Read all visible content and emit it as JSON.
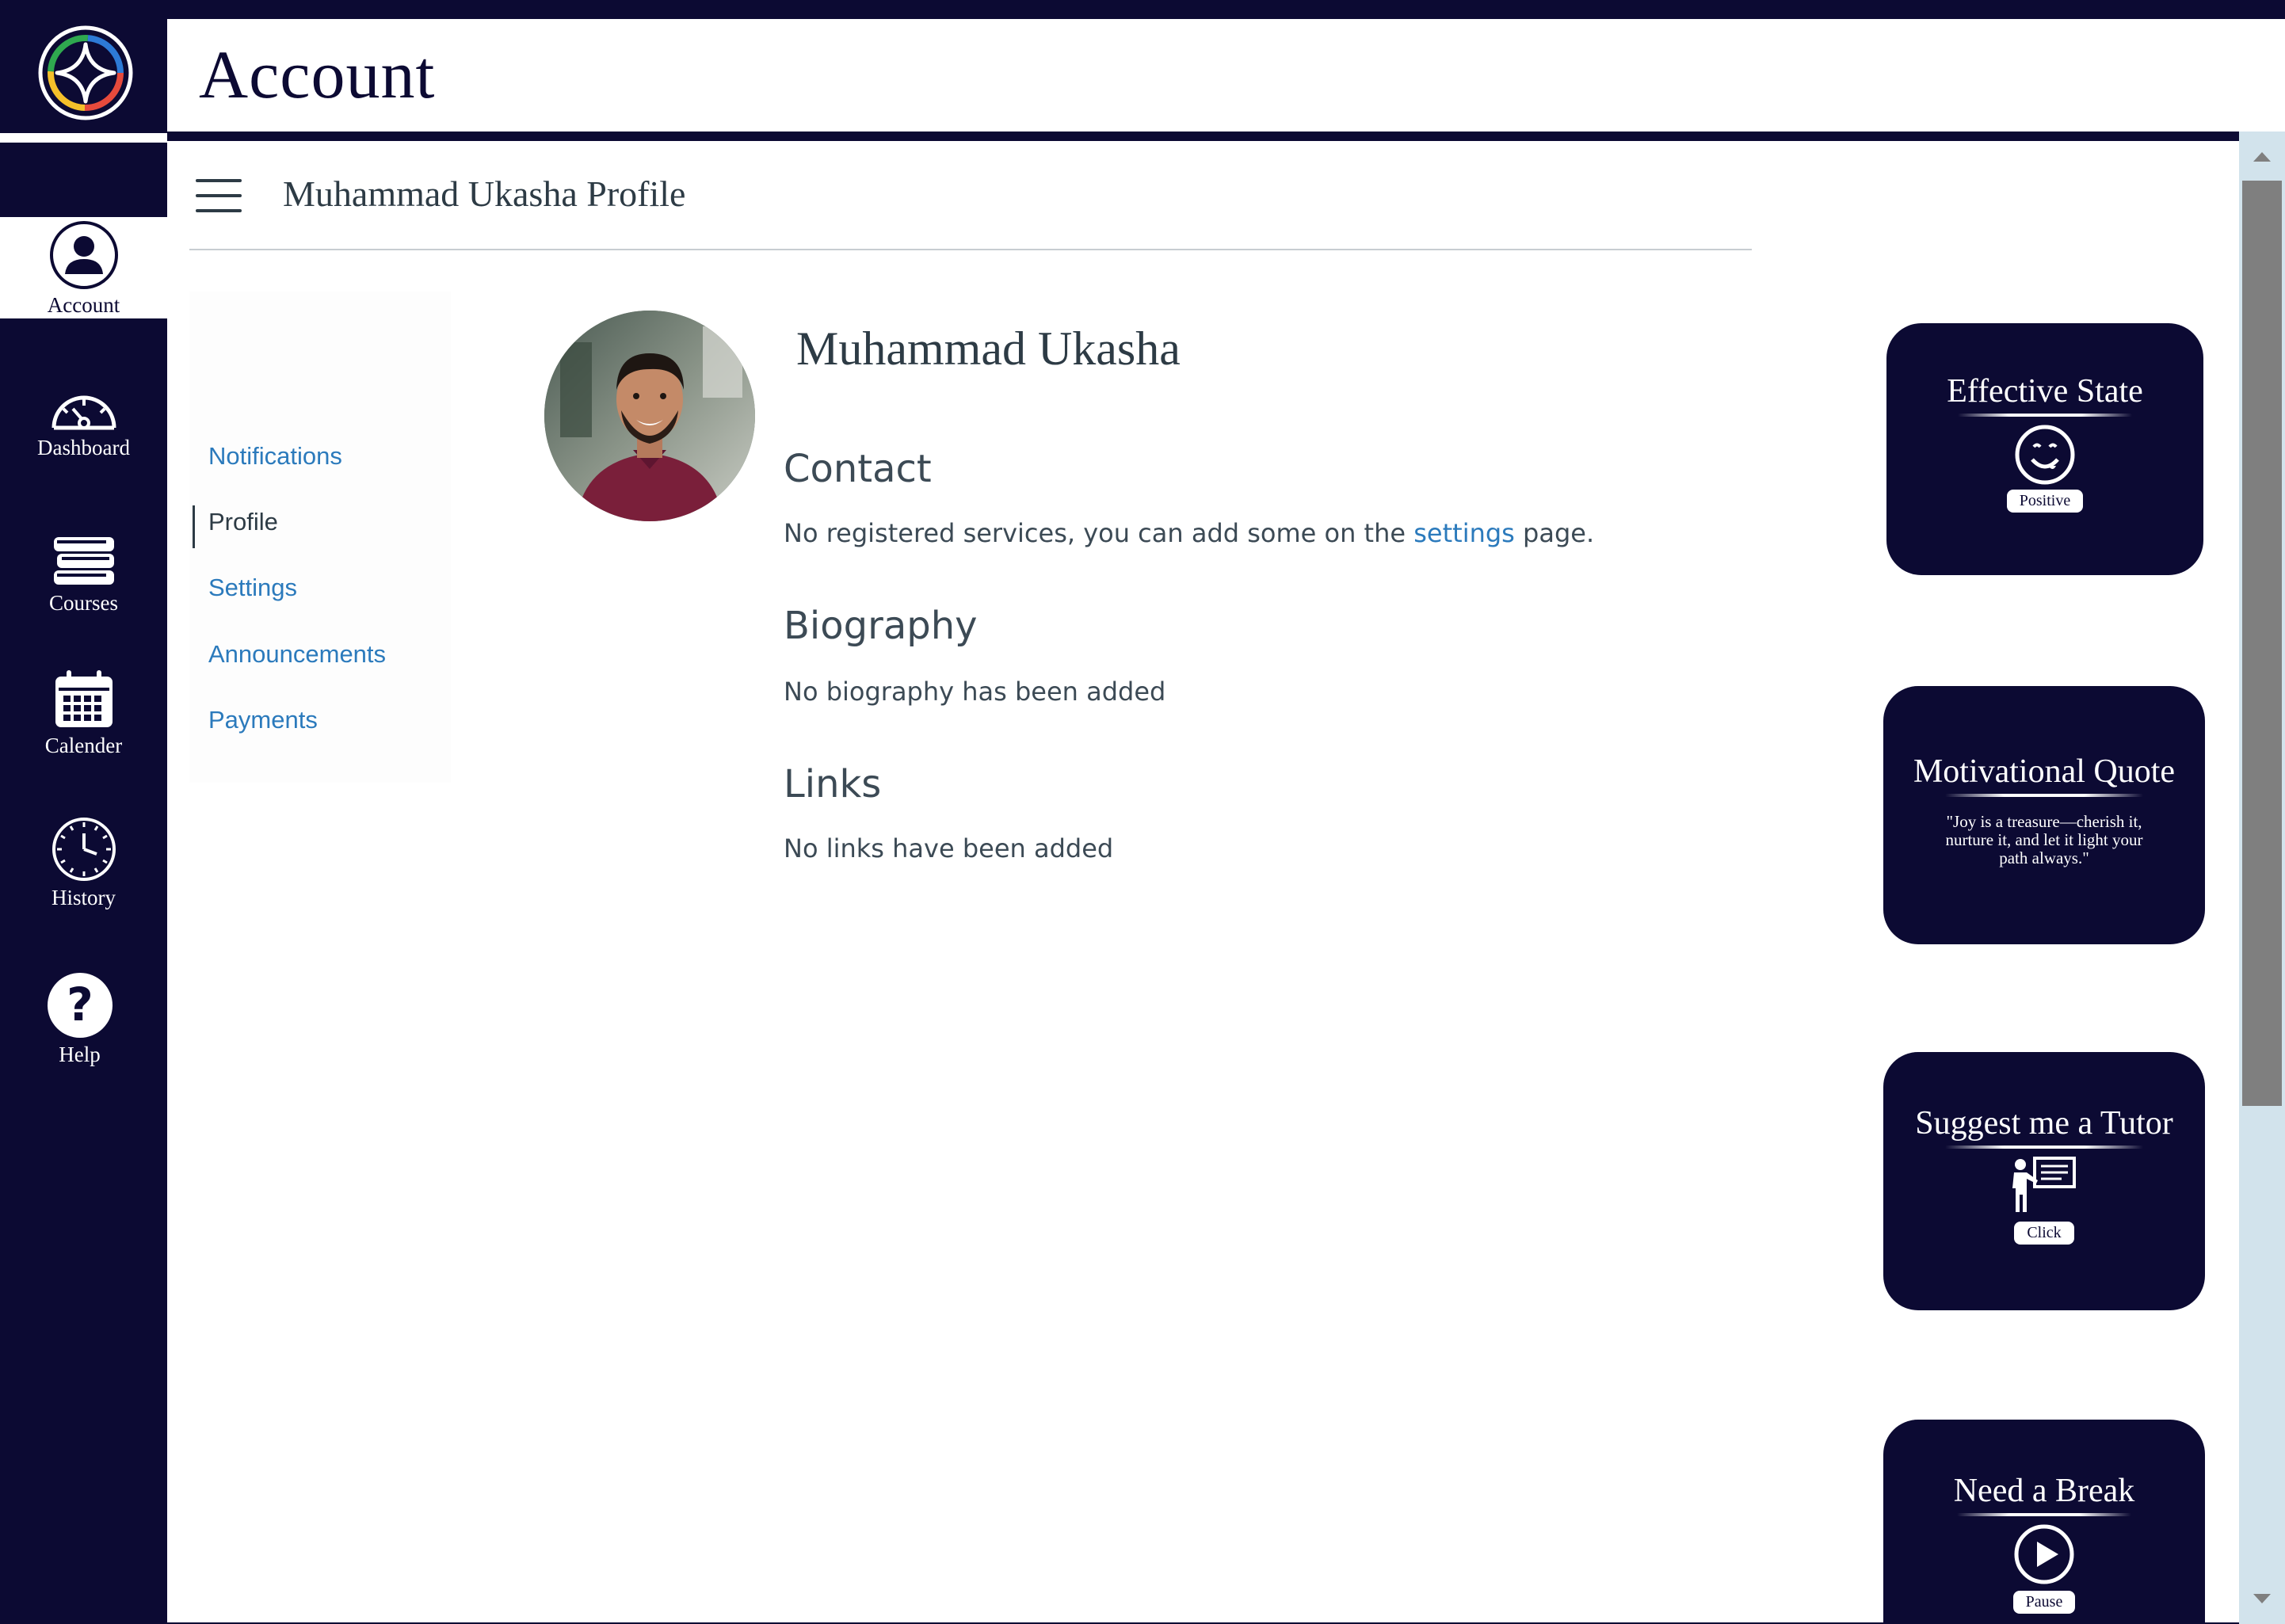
{
  "header": {
    "title": "Account"
  },
  "sidebar": {
    "items": [
      {
        "label": "Account",
        "icon": "user-icon"
      },
      {
        "label": "Dashboard",
        "icon": "speedometer-icon"
      },
      {
        "label": "Courses",
        "icon": "books-icon"
      },
      {
        "label": "Calender",
        "icon": "calendar-icon"
      },
      {
        "label": "History",
        "icon": "clock-icon"
      },
      {
        "label": "Help",
        "icon": "help-icon"
      }
    ],
    "active": "Account"
  },
  "page": {
    "heading": "Muhammad Ukasha Profile"
  },
  "subnav": {
    "items": [
      {
        "label": "Notifications"
      },
      {
        "label": "Profile"
      },
      {
        "label": "Settings"
      },
      {
        "label": "Announcements"
      },
      {
        "label": "Payments"
      }
    ],
    "current": "Profile"
  },
  "profile": {
    "name": "Muhammad Ukasha",
    "contact_title": "Contact",
    "contact_text_before": "No registered services, you can add some on the ",
    "contact_link": "settings",
    "contact_text_after": " page.",
    "biography_title": "Biography",
    "biography_text": "No biography has been added",
    "links_title": "Links",
    "links_text": "No links have been added"
  },
  "widgets": {
    "effective_state": {
      "title": "Effective State",
      "button": "Positive",
      "icon": "smiley-icon"
    },
    "motivational_quote": {
      "title": "Motivational Quote",
      "quote": "\"Joy is a treasure—cherish it, nurture it, and let it light your path always.\""
    },
    "tutor": {
      "title": "Suggest me a Tutor",
      "button": "Click",
      "icon": "teacher-board-icon"
    },
    "break": {
      "title": "Need a Break",
      "button": "Pause",
      "icon": "play-icon"
    }
  },
  "colors": {
    "navy": "#0c0a33",
    "link": "#2b7abc",
    "text": "#2d3b45",
    "scroll_track": "#d2e3ec"
  }
}
